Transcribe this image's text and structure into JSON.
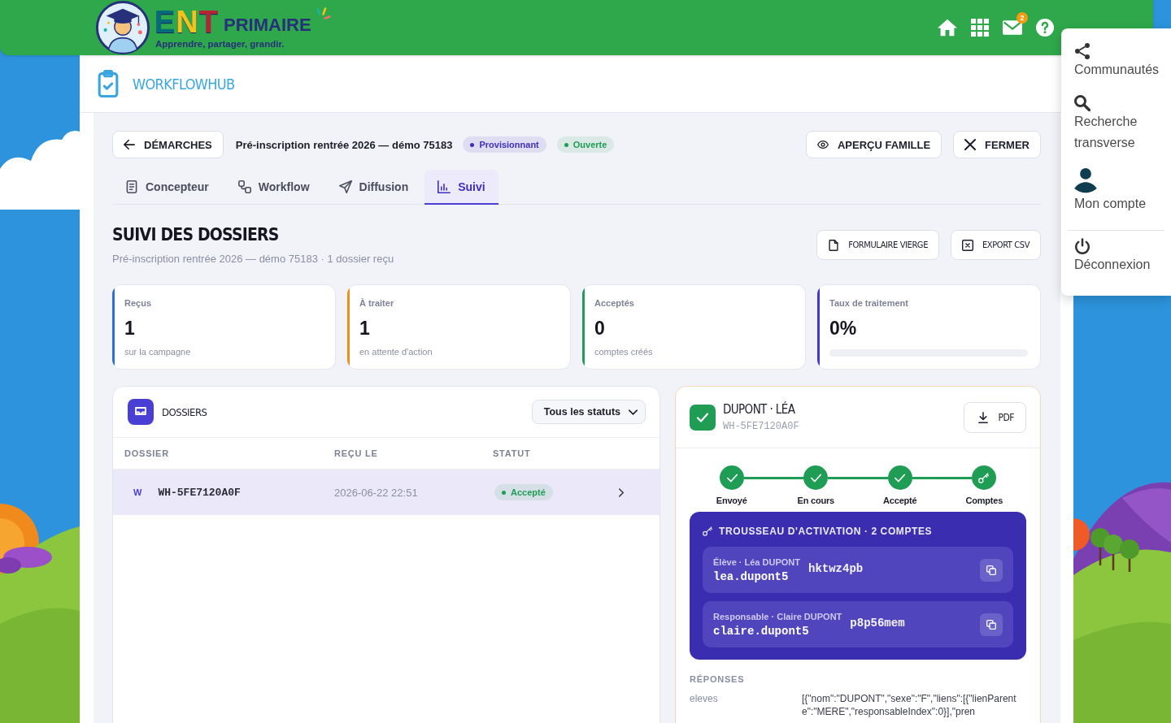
{
  "header": {
    "logo": {
      "brand": "ENT",
      "name": "PRIMAIRE",
      "tagline": "Apprendre, partager, grandir."
    },
    "mail_badge": "2"
  },
  "user_menu": {
    "groups": [
      [
        {
          "label": "Communautés"
        },
        {
          "label": "Recherche transverse"
        },
        {
          "label": "Mon compte"
        }
      ],
      [
        {
          "label": "Déconnexion"
        }
      ]
    ]
  },
  "app": {
    "title": "WORKFLOWHUB"
  },
  "toolbar": {
    "back_button": "DÉMARCHES",
    "campaign_title": "Pré-inscription rentrée 2026 — démo 75183",
    "badges": [
      {
        "label": "Provisionnant",
        "color": "#3f2fbf"
      },
      {
        "label": "Ouverte",
        "color": "#1f9d55"
      }
    ],
    "actions": [
      {
        "label": "APERÇU FAMILLE"
      },
      {
        "label": "FERMER"
      }
    ]
  },
  "tabs": [
    {
      "label": "Concepteur",
      "selected": false
    },
    {
      "label": "Workflow",
      "selected": false
    },
    {
      "label": "Diffusion",
      "selected": false
    },
    {
      "label": "Suivi",
      "selected": true
    }
  ],
  "section": {
    "title": "SUIVI DES DOSSIERS",
    "subtitle": "Pré-inscription rentrée 2026 — démo 75183 · 1 dossier reçu",
    "actions": [
      {
        "label": "FORMULAIRE VIERGE"
      },
      {
        "label": "EXPORT CSV"
      }
    ]
  },
  "stats": [
    {
      "kind": "caption",
      "label": "Reçus",
      "value": "1",
      "caption": "sur la campagne",
      "color": "#2f6fd8"
    },
    {
      "kind": "caption",
      "label": "À traiter",
      "value": "1",
      "caption": "en attente d'action",
      "color": "#e8921a"
    },
    {
      "kind": "caption",
      "label": "Acceptés",
      "value": "0",
      "caption": "comptes créés",
      "color": "#1f9d55"
    },
    {
      "kind": "progress",
      "label": "Taux de traitement",
      "value": "0%",
      "level": 0,
      "color": "#4536d6"
    }
  ],
  "dossiers": {
    "title": "DOSSIERS",
    "filter": "Tous les statuts",
    "columns": [
      "DOSSIER",
      "REÇU LE",
      "STATUT"
    ],
    "rows": [
      {
        "initial": "W",
        "reference": "WH-5FE7120A0F",
        "received": "2026-06-22 22:51",
        "status": "Accepté",
        "color": "#1f9d55",
        "selected": true
      }
    ]
  },
  "detail": {
    "title": "DUPONT · LÉA",
    "reference": "WH-5FE7120A0F",
    "pdf_button": "PDF",
    "steps": [
      {
        "label": "Envoyé",
        "done": true
      },
      {
        "label": "En cours",
        "done": true
      },
      {
        "label": "Accepté",
        "done": true
      },
      {
        "label": "Comptes",
        "done": true
      }
    ],
    "keyring": {
      "title": "TROUSSEAU D'ACTIVATION · 2 COMPTES",
      "accounts": [
        {
          "role": "Élève · Léa DUPONT",
          "login": "lea.dupont5",
          "password": "hktwz4pb"
        },
        {
          "role": "Responsable · Claire DUPONT",
          "login": "claire.dupont5",
          "password": "p8p56mem"
        }
      ]
    },
    "responses": {
      "title": "RÉPONSES",
      "fields": [
        {
          "name": "eleves",
          "value": "[{\"nom\":\"DUPONT\",\"sexe\":\"F\",\"liens\":[{\"lienParente\":\"MERE\",\"responsableIndex\":0}],\"pren"
        }
      ]
    }
  }
}
